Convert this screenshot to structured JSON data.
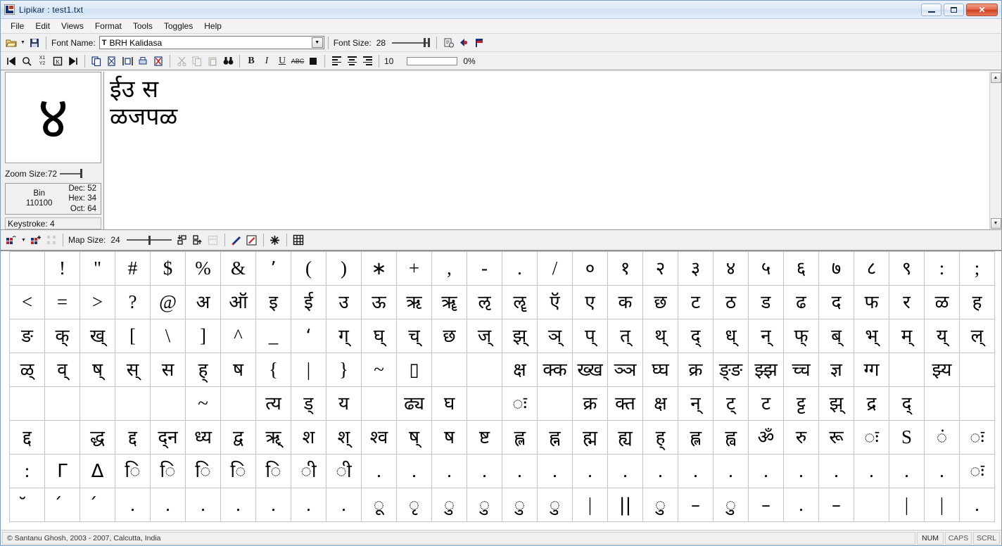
{
  "window": {
    "title": "Lipikar :  test1.txt",
    "icon": "lipikar-logo-icon",
    "minimize_label": "Minimize",
    "maximize_label": "Maximize",
    "close_label": "✕"
  },
  "menu": {
    "items": [
      {
        "label": "File"
      },
      {
        "label": "Edit"
      },
      {
        "label": "Views"
      },
      {
        "label": "Format"
      },
      {
        "label": "Tools"
      },
      {
        "label": "Toggles"
      },
      {
        "label": "Help"
      }
    ]
  },
  "toolbar_top": {
    "open_icon": "open-folder-icon",
    "open_dropdown_icon": "chevron-down-icon",
    "save_icon": "save-disk-icon",
    "font_name_label": "Font Name:",
    "font_name_value": "BRH Kalidasa",
    "font_combo_icon": "font-type-icon",
    "font_combo_arrow": "chevron-down-icon",
    "font_size_label": "Font Size:",
    "font_size_value": "28",
    "properties_icon": "page-properties-icon",
    "prev_icon": "blue-left-arrow-icon",
    "flag_icon": "red-flag-icon"
  },
  "toolbar_second": {
    "first_icon": "go-first-icon",
    "find_icon": "magnifier-icon",
    "x1y2_icon": "x1y2-icon",
    "box_icon": "boxed-k-icon",
    "last_icon": "go-last-icon",
    "copypage_icon": "copy-page-icon",
    "transform_icon": "transform-page-icon",
    "fit_icon": "fit-page-icon",
    "print_icon": "print-page-icon",
    "delete_icon": "delete-page-icon",
    "cut_icon": "scissors-icon",
    "copy_icon": "copy-icon",
    "paste_icon": "paste-icon",
    "findbinocular_icon": "binoculars-icon",
    "bold_label": "B",
    "italic_label": "I",
    "underline_label": "U",
    "strike_label": "ABC",
    "color_icon": "color-swatch-icon",
    "align_left_icon": "align-left-icon",
    "align_center_icon": "align-center-icon",
    "align_right_icon": "align-right-icon",
    "line_spacing_value": "10",
    "progress_label": "0%"
  },
  "left_panel": {
    "preview_glyph": "४",
    "zoom_label": "Zoom Size:",
    "zoom_value": "72",
    "bin_label": "Bin",
    "bin_value": "110100",
    "dec_label": "Dec: 52",
    "hex_label": "Hex: 34",
    "oct_label": "Oct: 64",
    "keystroke_label": "Keystroke: 4"
  },
  "editor": {
    "line1": "ईउ स",
    "line2": "ळजपळ"
  },
  "map_toolbar": {
    "map_open_icon": "map-open-icon",
    "map_dropdown_icon": "chevron-down-icon",
    "map_add_icon": "map-add-icon",
    "map_scatter_icon": "map-scatter-icon",
    "map_size_label": "Map Size:",
    "map_size_value": "24",
    "insert_below_icon": "insert-below-icon",
    "insert_above_icon": "insert-above-icon",
    "insert_table_icon": "insert-table-icon",
    "pen_icon": "edit-pen-icon",
    "brush_icon": "edit-brush-icon",
    "bold_grid_icon": "grid-star-icon",
    "grid_icon": "grid-toggle-icon"
  },
  "charmap": {
    "rows": [
      [
        "",
        "!",
        "\"",
        "#",
        "$",
        "%",
        "&",
        "’",
        "(",
        ")",
        "∗",
        "+",
        ",",
        "-",
        ".",
        "/",
        "०",
        "१",
        "२",
        "३",
        "४",
        "५",
        "६",
        "७",
        "८",
        "९",
        ":",
        ";"
      ],
      [
        "<",
        "=",
        ">",
        "?",
        "@",
        "अ",
        "ऑ",
        "इ",
        "ई",
        "उ",
        "ऊ",
        "ऋ",
        "ॠ",
        "ऌ",
        "ॡ",
        "ऍ",
        "ए",
        "क",
        "छ",
        "ट",
        "ठ",
        "ड",
        "ढ",
        "द",
        "फ",
        "र",
        "ळ",
        "ह"
      ],
      [
        "ङ",
        "क्",
        "ख्",
        "[",
        "\\",
        "]",
        "^",
        "_",
        "‘",
        "ग्",
        "घ्",
        "च्",
        "छ",
        "ज्",
        "झ्",
        "ञ्",
        "प्",
        "त्",
        "थ्",
        "द्",
        "ध्",
        "न्",
        "फ्",
        "ब्",
        "भ्",
        "म्",
        "य्",
        "ल्"
      ],
      [
        "ळ्",
        "व्",
        "ष्",
        "स्",
        "स",
        "ह्",
        "ष",
        "{",
        "|",
        "}",
        "~",
        "▯",
        "",
        "",
        "क्ष",
        "क्क",
        "ख्ख",
        "ञ्ञ",
        "घ्घ",
        "क्र",
        "ङ्ङ",
        "झ्झ",
        "च्च",
        "ज्ञ",
        "ग्ग",
        "",
        "झ्य",
        ""
      ],
      [
        "",
        "",
        "",
        "",
        "",
        "~",
        "",
        "त्य",
        "ड्",
        "य",
        "",
        "ढ्य",
        "घ",
        "",
        "ः",
        "",
        "क्र",
        "क्त",
        "क्ष",
        "न्",
        "ट्",
        "ट",
        "ट्ट",
        "झ्",
        "द्र",
        "द्",
        "",
        ""
      ],
      [
        "द्द",
        "",
        "द्ध",
        "द्द",
        "द्न",
        "ध्य",
        "द्व",
        "ऋ्",
        "श",
        "श्",
        "श्व",
        "ष्",
        "ष",
        "ष्ट",
        "ह्ल",
        "ह्न",
        "ह्म",
        "ह्य",
        "ह्",
        "ह्ल",
        "ह्व",
        "ॐ",
        "रु",
        "रू",
        "ः",
        "S",
        "ं",
        "ः"
      ],
      [
        ":",
        "Γ",
        "Δ",
        "ि",
        "ि",
        "ि",
        "ि",
        "ि",
        "ी",
        "ी",
        ".",
        ".",
        ".",
        ".",
        ".",
        ".",
        ".",
        ".",
        ".",
        ".",
        ".",
        ".",
        ".",
        ".",
        ".",
        ".",
        ".",
        "ः"
      ],
      [
        "̆",
        "́",
        "́",
        ".",
        ".",
        ".",
        ".",
        ".",
        ".",
        ".",
        "ू",
        "ृ",
        "ु",
        "ु",
        "ु",
        "ु",
        "|",
        "||",
        "ु",
        "–",
        "ु",
        "–",
        ".",
        "–",
        "",
        "|",
        "|",
        "."
      ]
    ]
  },
  "statusbar": {
    "copyright": "© Santanu Ghosh, 2003 - 2007, Calcutta, India",
    "num": "NUM",
    "caps": "CAPS",
    "scrl": "SCRL"
  }
}
